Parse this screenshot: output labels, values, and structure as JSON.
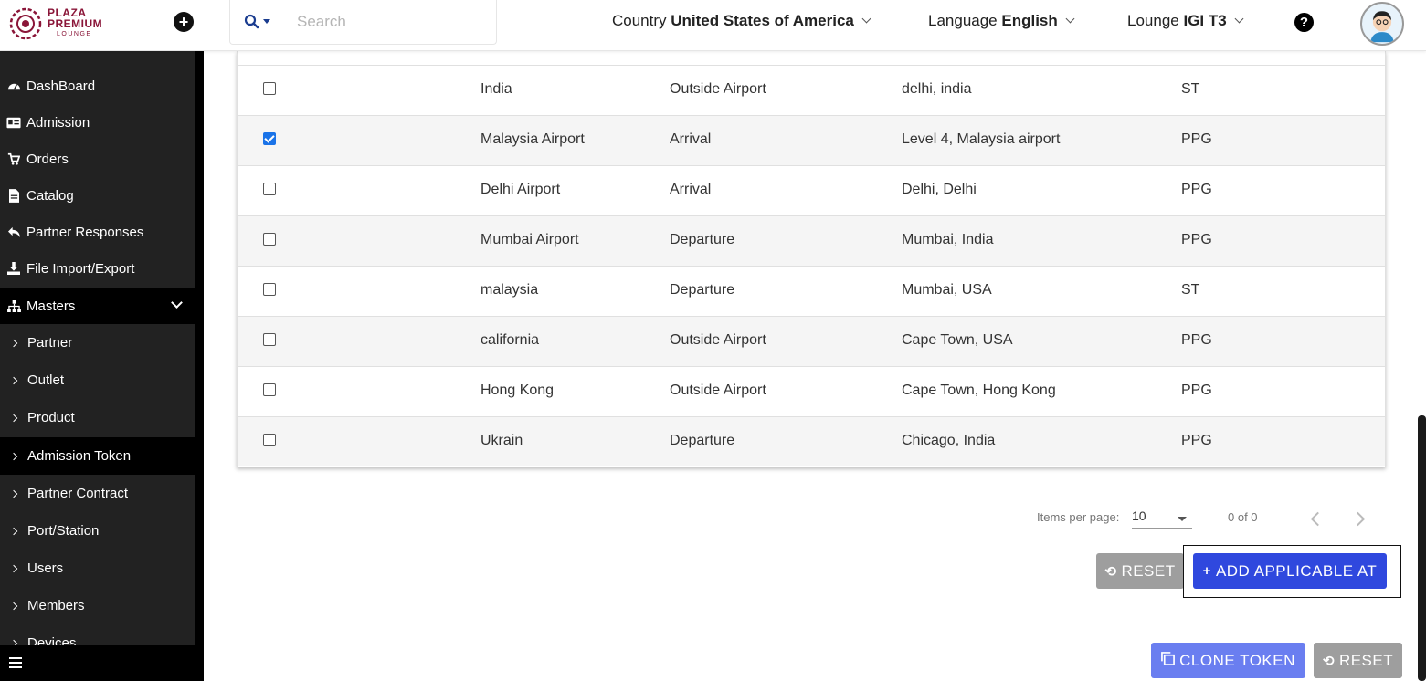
{
  "header": {
    "logo": {
      "line1": "PLAZA",
      "line2": "PREMIUM",
      "line3": "LOUNGE"
    },
    "search": {
      "placeholder": "Search"
    },
    "country": {
      "label": "Country",
      "value": "United States of America"
    },
    "language": {
      "label": "Language",
      "value": "English"
    },
    "lounge": {
      "label": "Lounge",
      "value": "IGI T3"
    },
    "plus_icon": "plus-circle-icon",
    "help_icon": "question-circle-icon"
  },
  "sidebar": {
    "items": [
      {
        "label": "DashBoard",
        "icon": "dashboard-icon"
      },
      {
        "label": "Admission",
        "icon": "id-card-icon"
      },
      {
        "label": "Orders",
        "icon": "cart-icon"
      },
      {
        "label": "Catalog",
        "icon": "file-icon"
      },
      {
        "label": "Partner Responses",
        "icon": "reply-all-icon"
      },
      {
        "label": "File Import/Export",
        "icon": "download-icon"
      },
      {
        "label": "Masters",
        "icon": "sitemap-icon"
      }
    ],
    "sub_items": [
      {
        "label": "Partner"
      },
      {
        "label": "Outlet"
      },
      {
        "label": "Product"
      },
      {
        "label": "Admission Token",
        "active": true
      },
      {
        "label": "Partner Contract"
      },
      {
        "label": "Port/Station"
      },
      {
        "label": "Users"
      },
      {
        "label": "Members"
      },
      {
        "label": "Devices"
      }
    ]
  },
  "table": {
    "rows": [
      {
        "checked": false,
        "name": "India",
        "type": "Outside Airport",
        "address": "delhi, india",
        "code": "ST"
      },
      {
        "checked": true,
        "name": "Malaysia Airport",
        "type": "Arrival",
        "address": "Level 4, Malaysia airport",
        "code": "PPG"
      },
      {
        "checked": false,
        "name": "Delhi Airport",
        "type": "Arrival",
        "address": "Delhi, Delhi",
        "code": "PPG"
      },
      {
        "checked": false,
        "name": "Mumbai Airport",
        "type": "Departure",
        "address": "Mumbai, India",
        "code": "PPG"
      },
      {
        "checked": false,
        "name": "malaysia",
        "type": "Departure",
        "address": "Mumbai, USA",
        "code": "ST"
      },
      {
        "checked": false,
        "name": "california",
        "type": "Outside Airport",
        "address": "Cape Town, USA",
        "code": "PPG"
      },
      {
        "checked": false,
        "name": "Hong Kong",
        "type": "Outside Airport",
        "address": "Cape Town, Hong Kong",
        "code": "PPG"
      },
      {
        "checked": false,
        "name": "Ukrain",
        "type": "Departure",
        "address": "Chicago, India",
        "code": "PPG"
      }
    ]
  },
  "paginator": {
    "items_per_page_label": "Items per page:",
    "items_per_page_value": "10",
    "range_label": "0 of 0"
  },
  "actions": {
    "reset_label": "RESET",
    "add_applicable_label": "ADD APPLICABLE AT",
    "clone_token_label": "CLONE TOKEN",
    "reset2_label": "RESET"
  },
  "colors": {
    "primary_blue": "#2f48de",
    "light_blue": "#6a7ef0",
    "grey_button": "#9e9e9e",
    "sidebar_bg": "#222222",
    "brand": "#8a1538"
  }
}
